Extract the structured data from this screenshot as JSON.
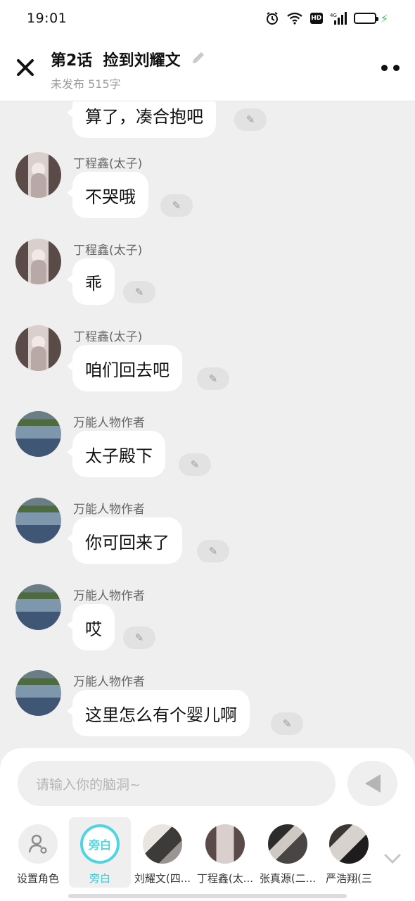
{
  "status_bar": {
    "time": "19:01",
    "icons": [
      "alarm-icon",
      "wifi-icon",
      "hd-icon",
      "signal-4g-icon",
      "battery-icon",
      "charging-icon"
    ],
    "hd_label": "HD",
    "network_label": "4G",
    "battery_level": 0.9,
    "battery_color": "#35c25a"
  },
  "header": {
    "title": "第2话  捡到刘耀文",
    "subtitle": "未发布 515字"
  },
  "messages": [
    {
      "sender": "",
      "text": "算了，凑合抱吧",
      "avatar": "ding"
    },
    {
      "sender": "丁程鑫(太子)",
      "text": "不哭哦",
      "avatar": "ding"
    },
    {
      "sender": "丁程鑫(太子)",
      "text": "乖",
      "avatar": "ding"
    },
    {
      "sender": "丁程鑫(太子)",
      "text": "咱们回去吧",
      "avatar": "ding"
    },
    {
      "sender": "万能人物作者",
      "text": "太子殿下",
      "avatar": "lake"
    },
    {
      "sender": "万能人物作者",
      "text": "你可回来了",
      "avatar": "lake"
    },
    {
      "sender": "万能人物作者",
      "text": "哎",
      "avatar": "lake"
    },
    {
      "sender": "万能人物作者",
      "text": "这里怎么有个婴儿啊",
      "avatar": "lake"
    }
  ],
  "composer": {
    "placeholder": "请输入你的脑洞~"
  },
  "roles": [
    {
      "label": "设置角色"
    },
    {
      "label": "旁白",
      "avatar_text": "旁白"
    },
    {
      "label": "刘耀文(四..."
    },
    {
      "label": "丁程鑫(太..."
    },
    {
      "label": "张真源(二..."
    },
    {
      "label": "严浩翔(三"
    }
  ],
  "colors": {
    "accent": "#4fd5df",
    "background": "#efefef"
  }
}
